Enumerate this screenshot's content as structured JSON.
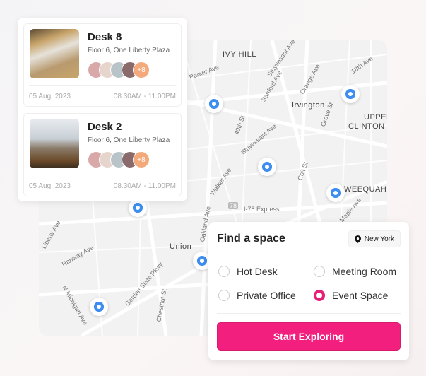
{
  "map": {
    "labels": [
      "IVY HILL",
      "Parker Ave",
      "Stuyvesant Ave",
      "Sanford Ave",
      "Orange Ave",
      "18th Ave",
      "Irvington",
      "UPPER",
      "CLINTON",
      "Grove St",
      "40th St",
      "Stuyvesant Ave",
      "Walker Ave",
      "Coit St",
      "WEEQUAHIC",
      "I-78 Express",
      "78",
      "Maple Ave",
      "Oakland Ave",
      "Union",
      "Liberty Ave",
      "Rahway Ave",
      "Garden State Pkwy",
      "Chestnut St",
      "N Michigan Ave"
    ],
    "pin_color": "#3d8ef0"
  },
  "bookings": [
    {
      "title": "Desk 8",
      "location": "Floor 6, One Liberty Plaza",
      "extra_count": "+8",
      "date": "05 Aug, 2023",
      "time": "08.30AM - 11.00PM"
    },
    {
      "title": "Desk 2",
      "location": "Floor 6, One Liberty Plaza",
      "extra_count": "+8",
      "date": "05 Aug, 2023",
      "time": "08.30AM - 11.00PM"
    }
  ],
  "finder": {
    "title": "Find a space",
    "city": "New York",
    "options": [
      {
        "label": "Hot Desk",
        "selected": false
      },
      {
        "label": "Meeting Room",
        "selected": false
      },
      {
        "label": "Private Office",
        "selected": false
      },
      {
        "label": "Event Space",
        "selected": true
      }
    ],
    "button": "Start Exploring",
    "accent": "#f21f7f"
  }
}
